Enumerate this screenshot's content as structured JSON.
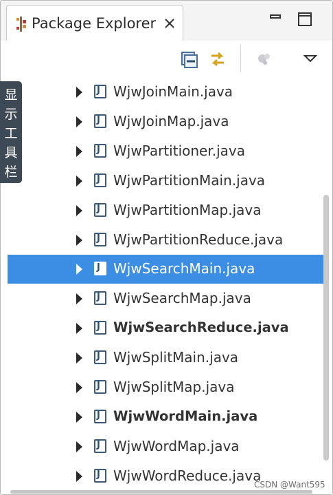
{
  "view": {
    "title": "Package Explorer",
    "title_icon": "package-explorer-icon",
    "close_icon": "close-icon",
    "minimize_icon": "minimize-icon",
    "maximize_icon": "maximize-icon"
  },
  "toolbar": {
    "buttons": [
      {
        "icon": "collapse-all-icon"
      },
      {
        "icon": "link-with-editor-icon"
      },
      {
        "icon": "focus-on-active-task-icon"
      },
      {
        "icon": "view-menu-icon"
      }
    ]
  },
  "side_tab": {
    "label": "显示工具栏"
  },
  "tree": {
    "items": [
      {
        "label": "WjwJoinMain.java",
        "bold": false,
        "selected": false,
        "icon": "java-file-icon"
      },
      {
        "label": "WjwJoinMap.java",
        "bold": false,
        "selected": false,
        "icon": "java-file-icon"
      },
      {
        "label": "WjwPartitioner.java",
        "bold": false,
        "selected": false,
        "icon": "java-file-icon"
      },
      {
        "label": "WjwPartitionMain.java",
        "bold": false,
        "selected": false,
        "icon": "java-file-icon"
      },
      {
        "label": "WjwPartitionMap.java",
        "bold": false,
        "selected": false,
        "icon": "java-file-icon"
      },
      {
        "label": "WjwPartitionReduce.java",
        "bold": false,
        "selected": false,
        "icon": "java-file-icon"
      },
      {
        "label": "WjwSearchMain.java",
        "bold": false,
        "selected": true,
        "icon": "java-file-icon"
      },
      {
        "label": "WjwSearchMap.java",
        "bold": false,
        "selected": false,
        "icon": "java-file-icon"
      },
      {
        "label": "WjwSearchReduce.java",
        "bold": true,
        "selected": false,
        "icon": "java-file-icon"
      },
      {
        "label": "WjwSplitMain.java",
        "bold": false,
        "selected": false,
        "icon": "java-file-icon"
      },
      {
        "label": "WjwSplitMap.java",
        "bold": false,
        "selected": false,
        "icon": "java-file-icon"
      },
      {
        "label": "WjwWordMain.java",
        "bold": true,
        "selected": false,
        "icon": "java-file-icon"
      },
      {
        "label": "WjwWordMap.java",
        "bold": false,
        "selected": false,
        "icon": "java-file-icon"
      },
      {
        "label": "WjwWordReduce.java",
        "bold": false,
        "selected": false,
        "icon": "java-file-icon"
      }
    ]
  },
  "watermark": "CSDN @Want595",
  "colors": {
    "selection": "#3c8ee5",
    "side_tab": "#3d4a55"
  }
}
